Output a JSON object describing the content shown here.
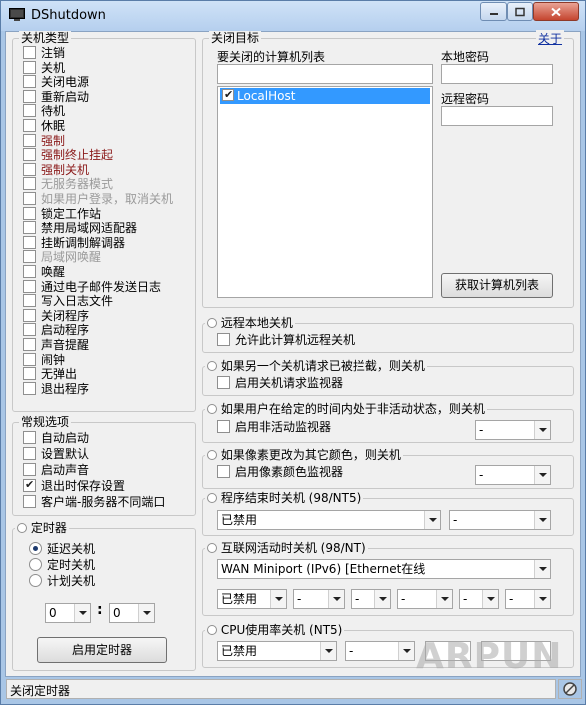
{
  "window": {
    "title": "DShutdown",
    "about_link": "关于"
  },
  "shutdown_type": {
    "legend": "关机类型",
    "items": [
      {
        "label": "注销",
        "style": "normal"
      },
      {
        "label": "关机",
        "style": "normal"
      },
      {
        "label": "关闭电源",
        "style": "normal"
      },
      {
        "label": "重新启动",
        "style": "normal"
      },
      {
        "label": "待机",
        "style": "normal"
      },
      {
        "label": "休眠",
        "style": "normal"
      },
      {
        "label": "强制",
        "style": "red"
      },
      {
        "label": "强制终止挂起",
        "style": "red"
      },
      {
        "label": "强制关机",
        "style": "red"
      },
      {
        "label": "无服务器模式",
        "style": "gray"
      },
      {
        "label": "如果用户登录，取消关机",
        "style": "gray"
      },
      {
        "label": "锁定工作站",
        "style": "normal"
      },
      {
        "label": "禁用局域网适配器",
        "style": "normal"
      },
      {
        "label": "挂断调制解调器",
        "style": "normal"
      },
      {
        "label": "局域网唤醒",
        "style": "gray"
      },
      {
        "label": "唤醒",
        "style": "normal"
      },
      {
        "label": "通过电子邮件发送日志",
        "style": "normal"
      },
      {
        "label": "写入日志文件",
        "style": "normal"
      },
      {
        "label": "关闭程序",
        "style": "normal"
      },
      {
        "label": "启动程序",
        "style": "normal"
      },
      {
        "label": "声音提醒",
        "style": "normal"
      },
      {
        "label": "闹钟",
        "style": "normal"
      },
      {
        "label": "无弹出",
        "style": "normal"
      },
      {
        "label": "退出程序",
        "style": "normal"
      }
    ]
  },
  "general_options": {
    "legend": "常规选项",
    "items": [
      {
        "label": "自动启动",
        "checked": false
      },
      {
        "label": "设置默认",
        "checked": false
      },
      {
        "label": "启动声音",
        "checked": false
      },
      {
        "label": "退出时保存设置",
        "checked": true
      },
      {
        "label": "客户端-服务器不同端口",
        "checked": false
      }
    ]
  },
  "timer": {
    "legend": "定时器",
    "radios": [
      {
        "label": "延迟关机",
        "selected": true
      },
      {
        "label": "定时关机",
        "selected": false
      },
      {
        "label": "计划关机",
        "selected": false
      }
    ],
    "hour": "0",
    "colon": ":",
    "minute": "0",
    "start_button": "启用定时器"
  },
  "target": {
    "legend": "关闭目标",
    "list_label": "要关闭的计算机列表",
    "list_input": "",
    "hosts": [
      {
        "name": "LocalHost",
        "checked": true,
        "selected": true
      }
    ],
    "local_password_label": "本地密码",
    "local_password": "",
    "remote_password_label": "远程密码",
    "remote_password": "",
    "get_list_button": "获取计算机列表"
  },
  "remote_shutdown": {
    "legend": "远程本地关机",
    "checkbox": "允许此计算机远程关机"
  },
  "request_blocked": {
    "legend": "如果另一个关机请求已被拦截，则关机",
    "checkbox": "启用关机请求监视器"
  },
  "inactive": {
    "legend": "如果用户在给定的时间内处于非活动状态，则关机",
    "checkbox": "启用非活动监视器",
    "combo": "-"
  },
  "pixel_color": {
    "legend": "如果像素更改为其它颜色，则关机",
    "checkbox": "启用像素颜色监视器",
    "combo": "-"
  },
  "program_end": {
    "legend": "程序结束时关机 (98/NT5)",
    "combo1": "已禁用",
    "combo2": "-"
  },
  "internet": {
    "legend": "互联网活动时关机 (98/NT)",
    "adapter": "WAN Miniport (IPv6) [Ethernet在线",
    "combo1": "已禁用",
    "combo2": "-",
    "combo3": "-",
    "combo4": "-",
    "combo5": "-",
    "combo6": "-"
  },
  "cpu": {
    "legend": "CPU使用率关机 (NT5)",
    "combo1": "已禁用",
    "combo2": "-"
  },
  "status": {
    "text": "关闭定时器"
  },
  "watermark": "ARPUN"
}
